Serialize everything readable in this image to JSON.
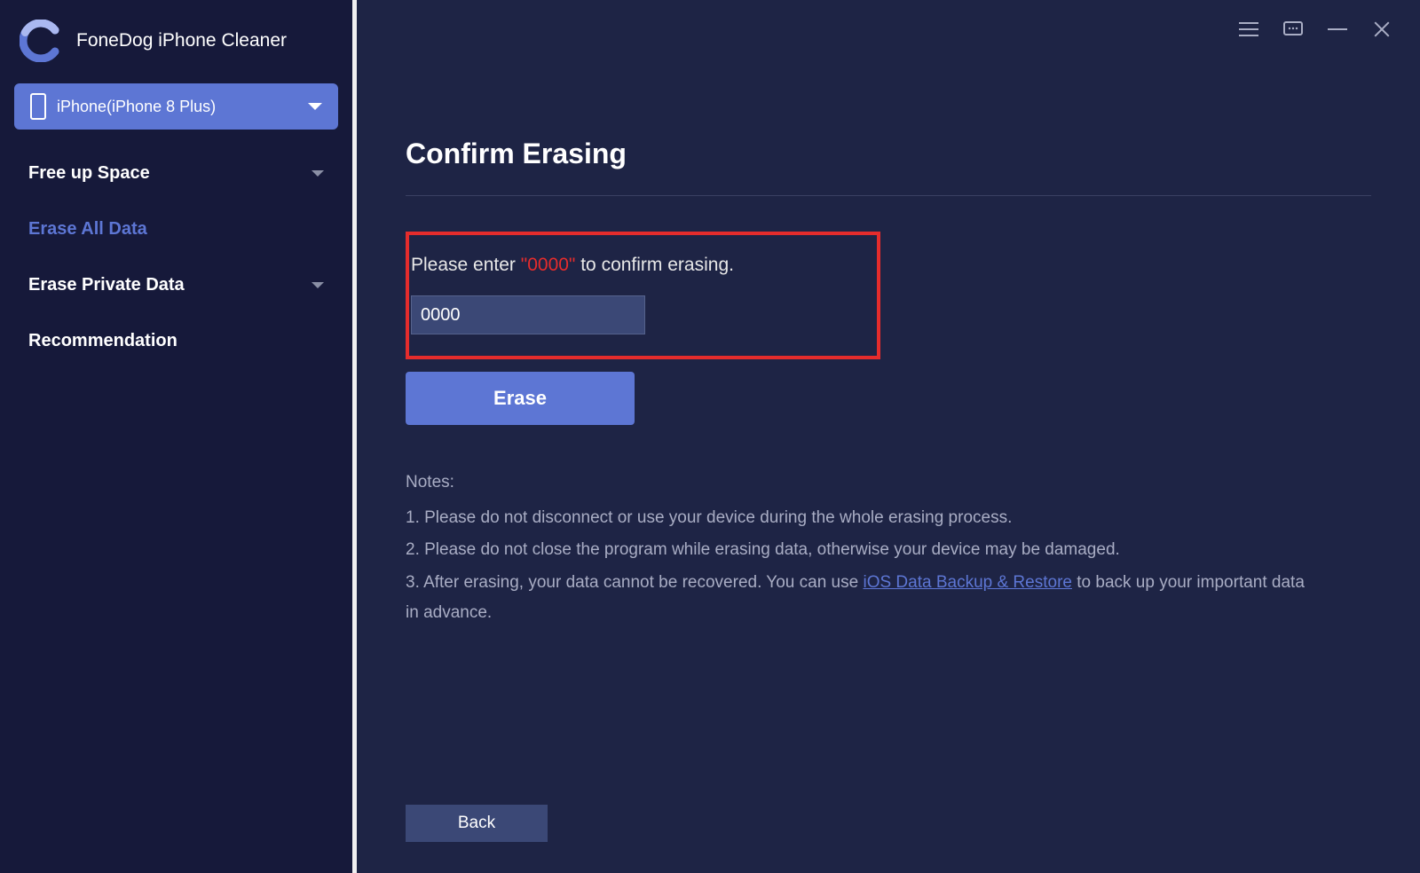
{
  "app": {
    "title": "FoneDog iPhone Cleaner"
  },
  "device": {
    "label": "iPhone(iPhone 8 Plus)"
  },
  "sidebar": {
    "items": [
      {
        "label": "Free up Space",
        "expandable": true
      },
      {
        "label": "Erase All Data",
        "active": true
      },
      {
        "label": "Erase Private Data",
        "expandable": true
      },
      {
        "label": "Recommendation"
      }
    ]
  },
  "main": {
    "title": "Confirm Erasing",
    "confirm_prefix": "Please enter ",
    "confirm_code": "\"0000\"",
    "confirm_suffix": " to confirm erasing.",
    "input_value": "0000",
    "erase_label": "Erase",
    "notes_header": "Notes:",
    "note1": "1. Please do not disconnect or use your device during the whole erasing process.",
    "note2": "2. Please do not close the program while erasing data, otherwise your device may be damaged.",
    "note3_prefix": "3. After erasing, your data cannot be recovered. You can use ",
    "note3_link": "iOS Data Backup & Restore",
    "note3_suffix": " to back up your important data in advance.",
    "back_label": "Back"
  }
}
